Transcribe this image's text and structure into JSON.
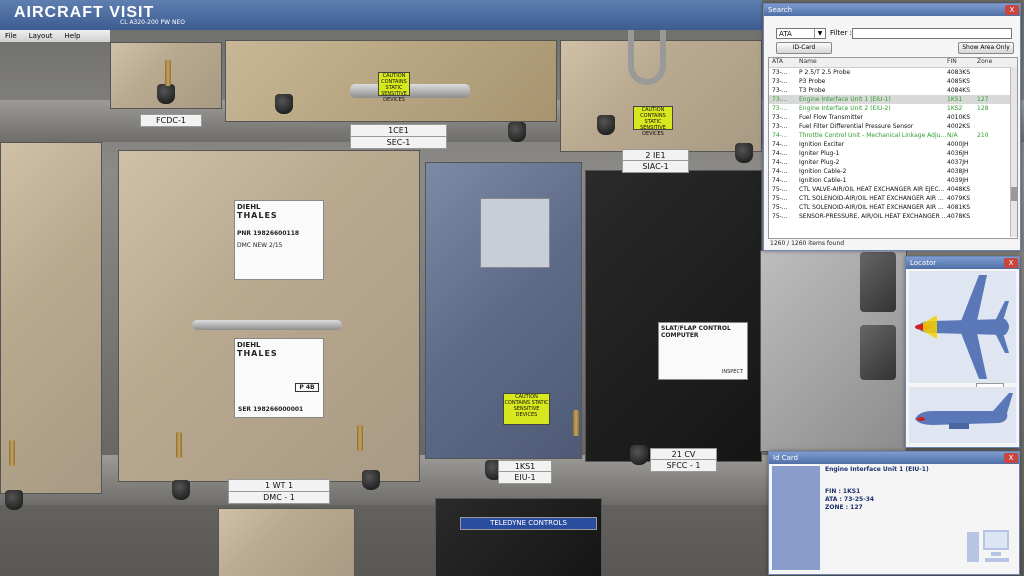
{
  "app": {
    "title": "AIRCRAFT VISIT",
    "subtitle": "CL A320-200 PW NEO"
  },
  "menu": [
    "File",
    "Layout",
    "Help"
  ],
  "scene_labels": {
    "fcdc": "FCDC-1",
    "sec1_code": "1CE1",
    "sec1": "SEC-1",
    "siac_code": "2 IE1",
    "siac": "SIAC-1",
    "dmc_code": "1 WT 1",
    "dmc": "DMC - 1",
    "eiu_code": "1KS1",
    "eiu": "EIU-1",
    "sfcc_code": "21 CV",
    "sfcc": "SFCC - 1",
    "sfcc_title": "SLAT/FLAP CONTROL COMPUTER",
    "diehl": "DIEHL",
    "thales": "THALES",
    "pnr1": "PNR 19826600118",
    "ser1": "SER 198266000001",
    "dmc_new": "DMC NEW 2/15",
    "teledyne": "TELEDYNE CONTROLS",
    "caution": "CAUTION CONTAINS STATIC SENSITIVE DEVICES",
    "inspect": "INSPECT",
    "p4b": "P 4B"
  },
  "search": {
    "title": "Search",
    "close": "X",
    "type_select": "ATA",
    "filter_label": "Filter :",
    "filter_value": "",
    "idcard_button": "ID-Card",
    "show_area_button": "Show Area Only",
    "columns": [
      "ATA",
      "Name",
      "FIN",
      "Zone"
    ],
    "rows": [
      {
        "ata": "73-...",
        "name": "P 2.5/T 2.5 Probe",
        "fin": "4083KS",
        "zone": "",
        "style": ""
      },
      {
        "ata": "73-...",
        "name": "P3 Probe",
        "fin": "4085KS",
        "zone": "",
        "style": ""
      },
      {
        "ata": "73-...",
        "name": "T3 Probe",
        "fin": "4084KS",
        "zone": "",
        "style": ""
      },
      {
        "ata": "73-...",
        "name": "Engine Interface Unit 1 (EIU-1)",
        "fin": "1KS1",
        "zone": "127",
        "style": "green sel"
      },
      {
        "ata": "73-...",
        "name": "Engine Interface Unit 2 (EIU-2)",
        "fin": "1KS2",
        "zone": "128",
        "style": "green"
      },
      {
        "ata": "73-...",
        "name": "Fuel Flow Transmitter",
        "fin": "4010KS",
        "zone": "",
        "style": ""
      },
      {
        "ata": "73-...",
        "name": "Fuel Filter Differential Pressure Sensor",
        "fin": "4002KS",
        "zone": "",
        "style": ""
      },
      {
        "ata": "74-...",
        "name": "Throttle Control Unit - Mechanical Linkage Adju...",
        "fin": "N/A",
        "zone": "210",
        "style": "green"
      },
      {
        "ata": "74-...",
        "name": "Ignition Exciter",
        "fin": "4000JH",
        "zone": "",
        "style": ""
      },
      {
        "ata": "74-...",
        "name": "Igniter Plug-1",
        "fin": "4036JH",
        "zone": "",
        "style": ""
      },
      {
        "ata": "74-...",
        "name": "Igniter Plug-2",
        "fin": "4037JH",
        "zone": "",
        "style": ""
      },
      {
        "ata": "74-...",
        "name": "Ignition Cable-2",
        "fin": "4038JH",
        "zone": "",
        "style": ""
      },
      {
        "ata": "74-...",
        "name": "Ignition Cable-1",
        "fin": "4039JH",
        "zone": "",
        "style": ""
      },
      {
        "ata": "75-...",
        "name": "CTL VALVE-AIR/OIL HEAT EXCHANGER AIR EJEC...",
        "fin": "4048KS",
        "zone": "",
        "style": ""
      },
      {
        "ata": "75-...",
        "name": "CTL SOLENOID-AIR/OIL HEAT EXCHANGER AIR ...",
        "fin": "4079KS",
        "zone": "",
        "style": ""
      },
      {
        "ata": "75-...",
        "name": "CTL SOLENOID-AIR/OIL HEAT EXCHANGER AIR ...",
        "fin": "4081KS",
        "zone": "",
        "style": ""
      },
      {
        "ata": "75-...",
        "name": "SENSOR-PRESSURE, AIR/OIL HEAT EXCHANGER ...",
        "fin": "4078KS",
        "zone": "",
        "style": ""
      }
    ],
    "found_text": "1260 / 1260 items found"
  },
  "locator": {
    "title": "Locator",
    "close": "X"
  },
  "idcard": {
    "title": "Id Card",
    "close": "X",
    "name": "Engine Interface Unit 1 (EIU-1)",
    "fin": "FIN : 1KS1",
    "ata": "ATA : 73-25-34",
    "zone": "ZONE : 127"
  },
  "colors": {
    "accent": "#4f6ea6",
    "highlight_green": "#2f9e2f",
    "close_red": "#c8463e",
    "plane_blue": "#5a78b8"
  }
}
